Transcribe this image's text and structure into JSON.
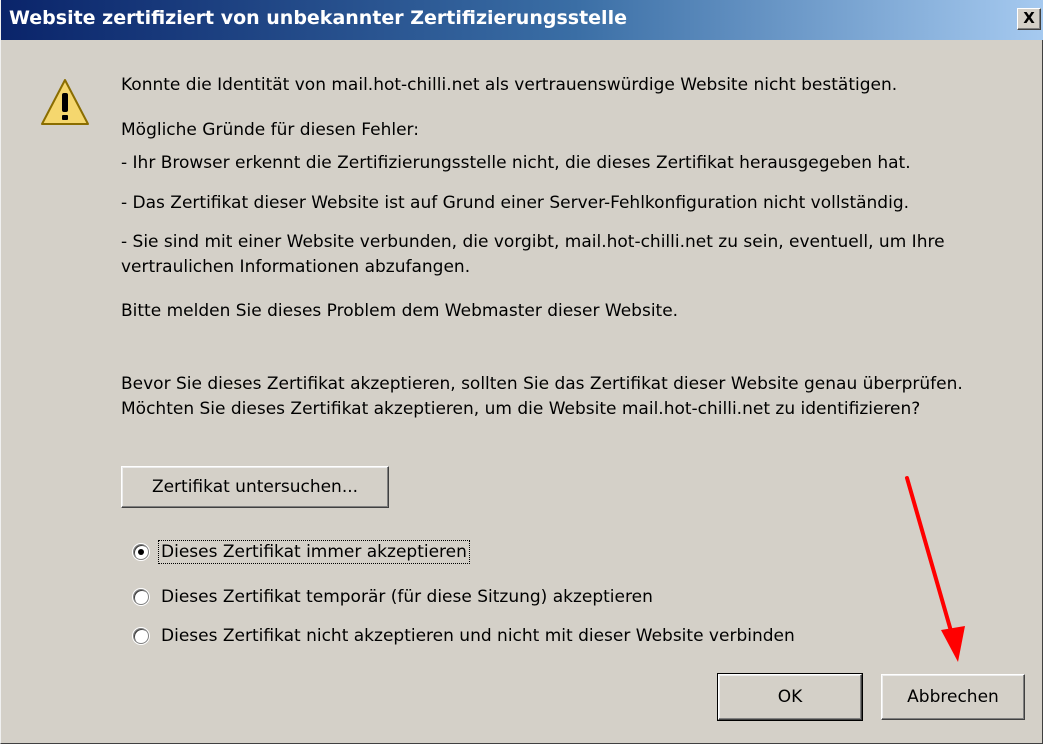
{
  "dialog": {
    "title": "Website zertifiziert von unbekannter Zertifizierungsstelle",
    "close_label": "X",
    "icon": "warning-icon"
  },
  "content": {
    "intro": "Konnte die Identität von mail.hot-chilli.net als vertrauenswürdige Website nicht bestätigen.",
    "reasons_heading": "Mögliche Gründe für diesen Fehler:",
    "reason_1": "- Ihr Browser erkennt die Zertifizierungsstelle nicht, die dieses Zertifikat herausgegeben hat.",
    "reason_2": "- Das Zertifikat dieser Website ist auf Grund einer Server-Fehlkonfiguration nicht vollständig.",
    "reason_3": "- Sie sind mit einer Website verbunden, die vorgibt, mail.hot-chilli.net zu sein, eventuell, um Ihre vertraulichen Informationen abzufangen.",
    "report": "Bitte melden Sie dieses Problem dem Webmaster dieser Website.",
    "question": "Bevor Sie dieses Zertifikat akzeptieren, sollten Sie das Zertifikat dieser Website genau überprüfen. Möchten Sie dieses Zertifikat akzeptieren, um die Website mail.hot-chilli.net zu identifizieren?"
  },
  "examine_button": "Zertifikat untersuchen...",
  "options": [
    {
      "label": "Dieses Zertifikat immer akzeptieren",
      "selected": true
    },
    {
      "label": "Dieses Zertifikat temporär (für diese Sitzung) akzeptieren",
      "selected": false
    },
    {
      "label": "Dieses Zertifikat nicht akzeptieren und nicht mit dieser Website verbinden",
      "selected": false
    }
  ],
  "buttons": {
    "ok": "OK",
    "cancel": "Abbrechen"
  },
  "colors": {
    "title_gradient_start": "#0a246a",
    "title_gradient_end": "#a6caf0",
    "dialog_bg": "#d4d0c8",
    "annotation_arrow": "#ff0000"
  }
}
